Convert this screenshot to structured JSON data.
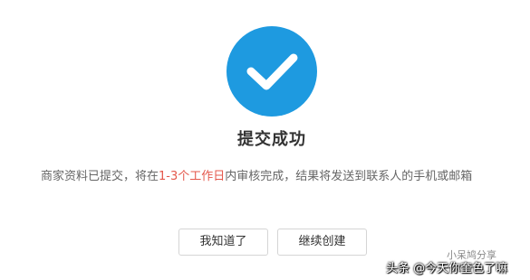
{
  "dialog": {
    "title": "提交成功",
    "message_prefix": "商家资料已提交，将在",
    "message_highlight": "1-3个工作日",
    "message_suffix": "内审核完成，结果将发送到联系人的手机或邮箱",
    "buttons": {
      "know_label": "我知道了",
      "continue_label": "继续创建"
    }
  },
  "watermark": {
    "main": "头条 @今天你奎色了嘛",
    "sub": "小呆鸠分享"
  },
  "colors": {
    "success": "#1e9ae0",
    "highlight": "#e4574b",
    "text": "#333333",
    "muted": "#666666"
  },
  "icons": {
    "success": "check-circle-icon"
  }
}
